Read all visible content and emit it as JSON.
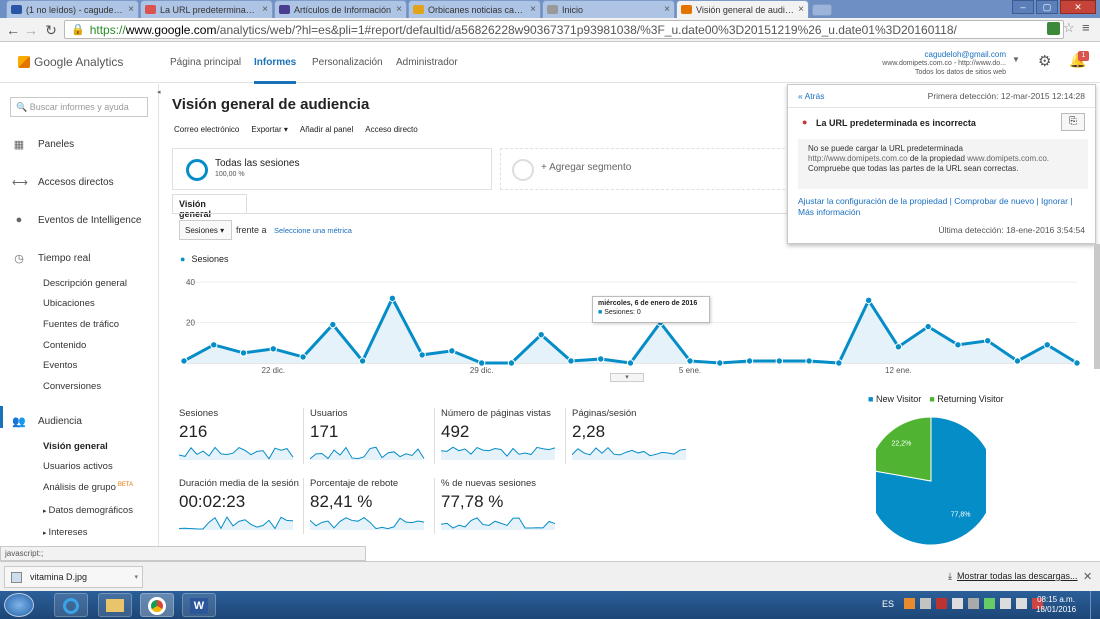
{
  "browser": {
    "tabs": [
      {
        "title": "(1 no leídos) - cagudeloh",
        "color": "#2855a6",
        "active": false
      },
      {
        "title": "La URL predeterminada es",
        "color": "#d9534f",
        "active": false
      },
      {
        "title": "Artículos de Información",
        "color": "#4a3d8f",
        "active": false
      },
      {
        "title": "Orbicanes noticias caninas",
        "color": "#e2a31a",
        "active": false
      },
      {
        "title": "Inicio",
        "color": "#999999",
        "active": false
      },
      {
        "title": "Visión general de audiencia",
        "color": "#e37400",
        "active": true
      }
    ],
    "tab_close": "×",
    "url_prefix": "https://",
    "url_domain": "www.google.com",
    "url_path": "/analytics/web/?hl=es&pli=1#report/defaultid/a56826228w90367371p93981038/%3F_u.date00%3D20151219%26_u.date01%3D20160118/"
  },
  "ga": {
    "logo": "Google Analytics",
    "nav": [
      "Página principal",
      "Informes",
      "Personalización",
      "Administrador"
    ],
    "account_email": "cagudeloh@gmail.com",
    "account_site": "www.domipets.com.co - http://www.do...",
    "account_view": "Todos los datos de sitios web",
    "notif_count": "1"
  },
  "sidebar": {
    "search_placeholder": "Buscar informes y ayuda",
    "items": [
      "Paneles",
      "Accesos directos",
      "Eventos de Intelligence",
      "Tiempo real"
    ],
    "realtime_sub": [
      "Descripción general",
      "Ubicaciones",
      "Fuentes de tráfico",
      "Contenido",
      "Eventos",
      "Conversiones"
    ],
    "audience": "Audiencia",
    "audience_sub": [
      "Visión general",
      "Usuarios activos",
      "Análisis de grupo",
      "Datos demográficos",
      "Intereses"
    ],
    "beta": "BETA"
  },
  "report": {
    "title": "Visión general de audiencia",
    "actions": [
      "Correo electrónico",
      "Exportar",
      "Añadir al panel",
      "Acceso directo"
    ],
    "segment_all": "Todas las sesiones",
    "segment_pct": "100,00 %",
    "segment_add": "+ Agregar segmento",
    "tab": "Visión general",
    "metric_select": "Sesiones",
    "versus": "frente a",
    "select_metric": "Seleccione una métrica",
    "legend": "Sesiones",
    "tooltip_date": "miércoles, 6 de enero de 2016",
    "tooltip_val": "Sesiones: 0"
  },
  "chart_data": {
    "type": "line",
    "x": [
      "19 dic.",
      "20 dic.",
      "21 dic.",
      "22 dic.",
      "23 dic.",
      "24 dic.",
      "25 dic.",
      "26 dic.",
      "27 dic.",
      "28 dic.",
      "29 dic.",
      "30 dic.",
      "31 dic.",
      "1 ene.",
      "2 ene.",
      "3 ene.",
      "4 ene.",
      "5 ene.",
      "6 ene.",
      "7 ene.",
      "8 ene.",
      "9 ene.",
      "10 ene.",
      "11 ene.",
      "12 ene.",
      "13 ene.",
      "14 ene.",
      "15 ene.",
      "16 ene.",
      "17 ene.",
      "18 ene."
    ],
    "series": [
      {
        "name": "Sesiones",
        "values": [
          1,
          9,
          5,
          7,
          3,
          19,
          1,
          32,
          4,
          6,
          0,
          0,
          14,
          1,
          2,
          0,
          20,
          1,
          0,
          1,
          1,
          1,
          0,
          31,
          8,
          18,
          9,
          11,
          1,
          9,
          0
        ]
      }
    ],
    "xticks": [
      "22 dic.",
      "29 dic.",
      "5 ene.",
      "12 ene."
    ],
    "yticks": [
      "40",
      "20"
    ],
    "ylim": [
      0,
      45
    ],
    "color": "#058dc7"
  },
  "kpis": [
    {
      "label": "Sesiones",
      "value": "216"
    },
    {
      "label": "Usuarios",
      "value": "171"
    },
    {
      "label": "Número de páginas vistas",
      "value": "492"
    },
    {
      "label": "Páginas/sesión",
      "value": "2,28"
    },
    {
      "label": "Duración media de la sesión",
      "value": "00:02:23"
    },
    {
      "label": "Porcentaje de rebote",
      "value": "82,41 %"
    },
    {
      "label": "% de nuevas sesiones",
      "value": "77,78 %"
    }
  ],
  "pie": {
    "legend": [
      "New Visitor",
      "Returning Visitor"
    ],
    "values": [
      77.8,
      22.2
    ],
    "labels": [
      "77,8%",
      "22,2%"
    ],
    "colors": [
      "#058dc7",
      "#50b432"
    ]
  },
  "panel": {
    "back": "« Atrás",
    "first_seen": "Primera detección: 12-mar-2015 12:14:28",
    "title": "La URL predeterminada es incorrecta",
    "body1": "No se puede cargar la URL predeterminada",
    "body2_a": "http://www.domipets.com.co",
    "body2_b": " de la propiedad ",
    "body2_c": "www.domipets.com.co.",
    "body3": "Compruebe que todas las partes de la URL sean correctas.",
    "links": "Ajustar la configuración de la propiedad | Comprobar de nuevo | Ignorar |",
    "more": "Más información",
    "last_seen": "Última detección: 18-ene-2016 3:54:54"
  },
  "status": "javascript:;",
  "download": {
    "file": "vitamina D.jpg",
    "show_all": "Mostrar todas las descargas..."
  },
  "taskbar": {
    "lang": "ES",
    "time": "08:15 a.m.",
    "date": "18/01/2016"
  }
}
